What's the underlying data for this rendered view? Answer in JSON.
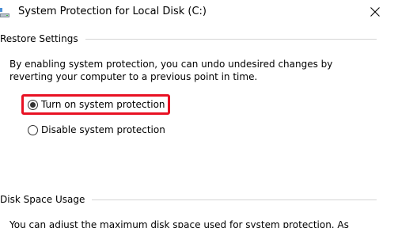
{
  "window": {
    "title": "System Protection for Local Disk (C:)",
    "icon": "drive-icon",
    "close_glyph": "✕"
  },
  "restore_settings": {
    "header": "Restore Settings",
    "description_line1": "By enabling system protection, you can undo undesired changes by",
    "description_line2": "reverting your computer to a previous point in time.",
    "options": [
      {
        "label": "Turn on system protection",
        "selected": true
      },
      {
        "label": "Disable system protection",
        "selected": false
      }
    ]
  },
  "disk_space": {
    "header": "Disk Space Usage",
    "description_line1": "You can adjust the maximum disk space used for system protection. As"
  },
  "colors": {
    "highlight": "#e81123",
    "group_line": "#d5d5d5"
  }
}
